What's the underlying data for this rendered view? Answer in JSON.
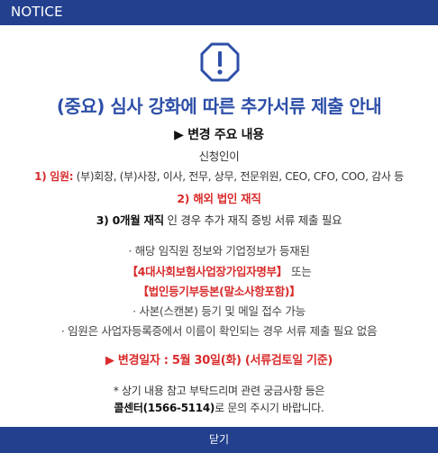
{
  "header": {
    "title": "NOTICE"
  },
  "notice": {
    "icon": "warning-octagon-icon",
    "title": "(중요) 심사 강화에 따른 추가서류 제출 안내",
    "subheading": "▶ 변경 주요 내용",
    "target": "신청인이",
    "officer_label": "1) 임원:",
    "officer_text": " (부)회장, (부)사장, 이사, 전무, 상무, 전문위원, CEO, CFO, COO, 감사 등",
    "overseas": "2) 해외 법인 재직",
    "zero_label": "3) 0개월 재직",
    "zero_text": " 인 경우 추가 재직 증빙 서류 제출 필요",
    "bullet1": "· 해당 임직원 정보와 기업정보가 등재된",
    "bullet2_bold": "【4대사회보험사업장가입자명부】",
    "bullet2_or": "또는",
    "bullet3": "【법인등기부등본(말소사항포함)】",
    "bullet4": "· 사본(스캔본) 등기 및 메일 접수 가능",
    "bullet5": "· 임원은 사업자등록증에서 이름이 확인되는 경우 서류 제출 필요 없음",
    "change_date": "▶ 변경일자 : 5월 30일(화) (서류검토일 기준)",
    "note1": "* 상기 내용 참고 부탁드리며 관련 궁금사항 등은",
    "note2_bold": "콜센터(1566-5114)",
    "note2_rest": "로 문의 주시기 바랍니다."
  },
  "footer": {
    "close_label": "닫기"
  },
  "colors": {
    "brand": "#23408e",
    "title": "#2d4fa8",
    "alert": "#d92b2b"
  }
}
